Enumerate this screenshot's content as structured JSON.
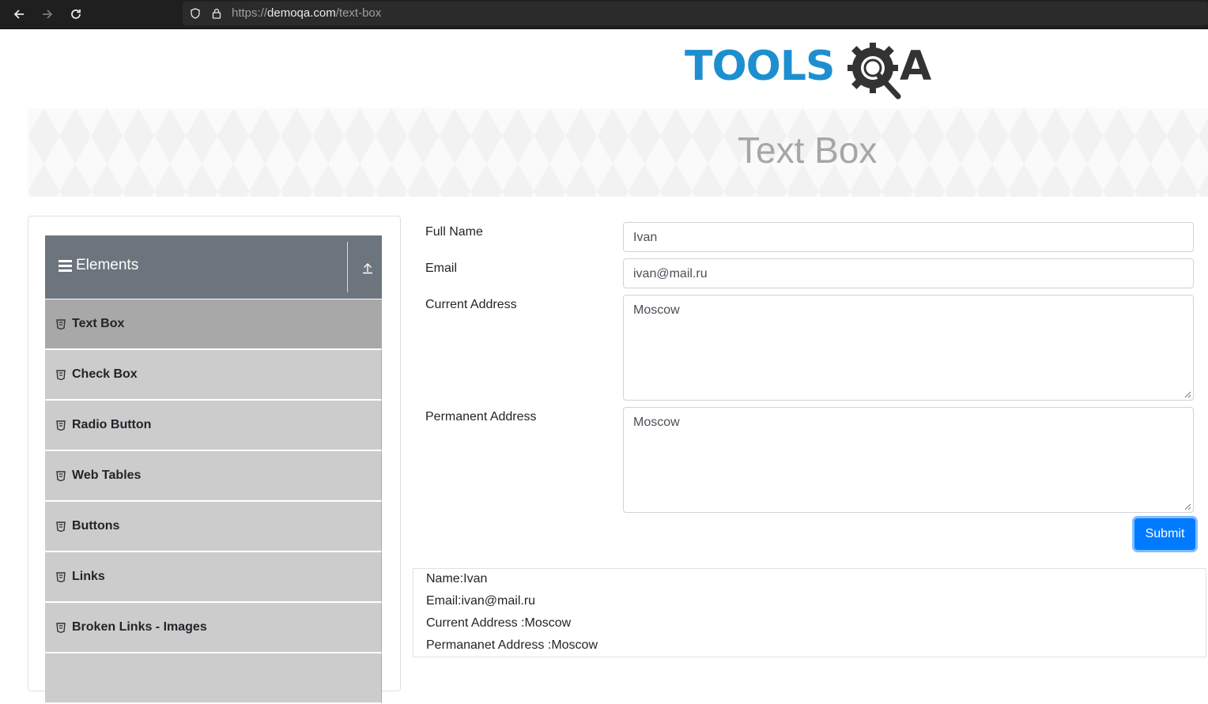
{
  "browser": {
    "url_prefix": "https://",
    "url_host": "demoqa.com",
    "url_path": "/text-box"
  },
  "logo": {
    "text_left": "TOOLS",
    "text_right": "A",
    "brand_color": "#1d8fd1"
  },
  "page": {
    "title": "Text Box"
  },
  "sidebar": {
    "group_label": "Elements",
    "items": [
      {
        "label": "Text Box",
        "active": true
      },
      {
        "label": "Check Box"
      },
      {
        "label": "Radio Button"
      },
      {
        "label": "Web Tables"
      },
      {
        "label": "Buttons"
      },
      {
        "label": "Links"
      },
      {
        "label": "Broken Links - Images"
      }
    ]
  },
  "form": {
    "full_name_label": "Full Name",
    "full_name_value": "Ivan",
    "email_label": "Email",
    "email_value": "ivan@mail.ru",
    "current_address_label": "Current Address",
    "current_address_value": "Moscow",
    "permanent_address_label": "Permanent Address",
    "permanent_address_value": "Moscow",
    "submit_label": "Submit",
    "submit_color": "#007bff"
  },
  "output": {
    "name": "Name:Ivan",
    "email": "Email:ivan@mail.ru",
    "current_address": "Current Address :Moscow",
    "permanent_address": "Permananet Address :Moscow"
  }
}
